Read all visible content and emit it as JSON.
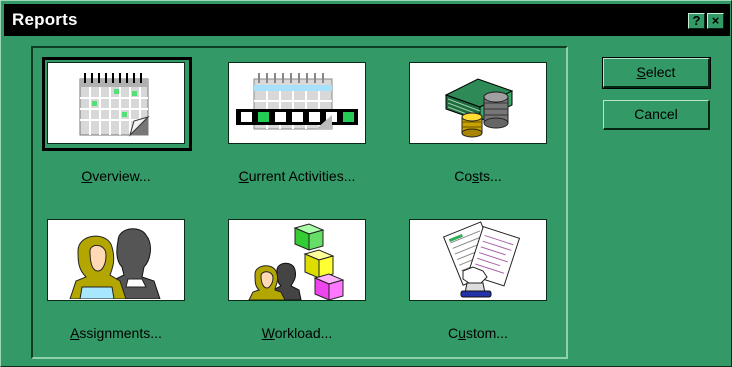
{
  "window": {
    "title": "Reports",
    "help_button": "?",
    "close_button": "×"
  },
  "buttons": {
    "select": {
      "label_prefix": "",
      "label_key": "S",
      "label_rest": "elect"
    },
    "cancel": {
      "label": "Cancel"
    }
  },
  "reports": [
    {
      "id": "overview",
      "pre": "",
      "key": "O",
      "post": "verview...",
      "icon": "calendar-icon",
      "selected": true
    },
    {
      "id": "current-activities",
      "pre": "",
      "key": "C",
      "post": "urrent Activities...",
      "icon": "activities-calendar-icon",
      "selected": false
    },
    {
      "id": "costs",
      "pre": "Co",
      "key": "s",
      "post": "ts...",
      "icon": "money-coins-icon",
      "selected": false
    },
    {
      "id": "assignments",
      "pre": "",
      "key": "A",
      "post": "ssignments...",
      "icon": "people-icon",
      "selected": false
    },
    {
      "id": "workload",
      "pre": "",
      "key": "W",
      "post": "orkload...",
      "icon": "workload-blocks-icon",
      "selected": false
    },
    {
      "id": "custom",
      "pre": "C",
      "key": "u",
      "post": "stom...",
      "icon": "custom-report-icon",
      "selected": false
    }
  ],
  "colors": {
    "dialog_bg": "#339966",
    "titlebar_bg": "#000000",
    "tile_bg": "#ffffff"
  }
}
